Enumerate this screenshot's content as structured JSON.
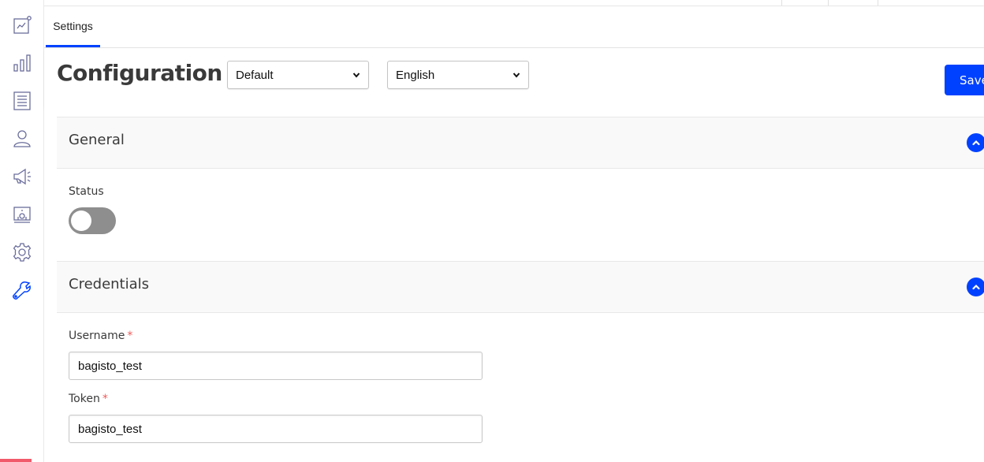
{
  "sidebar": {
    "items": [
      {
        "icon": "dashboard-chart-icon",
        "active": false
      },
      {
        "icon": "bar-chart-icon",
        "active": false
      },
      {
        "icon": "document-list-icon",
        "active": false
      },
      {
        "icon": "user-icon",
        "active": false
      },
      {
        "icon": "megaphone-icon",
        "active": false
      },
      {
        "icon": "cms-display-icon",
        "active": false
      },
      {
        "icon": "settings-gear-icon",
        "active": false
      },
      {
        "icon": "wrench-icon",
        "active": true
      }
    ],
    "icon_color": "#6b6e9c",
    "active_color": "#0041ff"
  },
  "tabs": [
    {
      "label": "Settings",
      "active": true
    }
  ],
  "header": {
    "title": "Configuration",
    "channel_select": {
      "value": "Default"
    },
    "locale_select": {
      "value": "English"
    },
    "save_label": "Save"
  },
  "sections": [
    {
      "title": "General",
      "fields": [
        {
          "label": "Status",
          "type": "toggle",
          "value": false
        }
      ]
    },
    {
      "title": "Credentials",
      "fields": [
        {
          "label": "Username",
          "required": true,
          "required_mark": "*",
          "value": "bagisto_test"
        },
        {
          "label": "Token",
          "required": true,
          "required_mark": "*",
          "value": "bagisto_test"
        }
      ]
    }
  ],
  "colors": {
    "accent": "#0041ff",
    "required": "#f05a5a",
    "toggle_off": "#8e8e8e"
  }
}
